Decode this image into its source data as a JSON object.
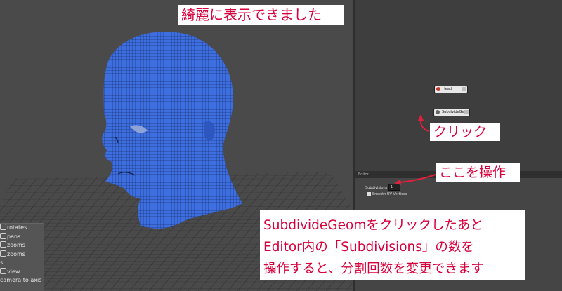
{
  "viewport": {
    "hud_items": [
      "rotates",
      "pans",
      "zooms",
      "zooms",
      "s",
      "view",
      "camera to axis"
    ]
  },
  "graph": {
    "nodes": [
      {
        "label": "Head",
        "icon": "mesh-icon"
      },
      {
        "label": "SubdivideGeom",
        "icon": "gear-icon"
      }
    ]
  },
  "attribute_editor": {
    "header": "Editor",
    "subdivisions_label": "Subdivisions",
    "subdivisions_value": "1",
    "smooth_uv_label": "Smooth UV Vertices"
  },
  "annotations": {
    "title": "綺麗に表示できました",
    "click": "クリック",
    "operate": "ここを操作",
    "description_lines": [
      "SubdivideGeomをクリックしたあと",
      "Editor内の「Subdivisions」の数を",
      "操作すると、分割回数を変更できます"
    ]
  },
  "colors": {
    "mesh": "#3e6fe0",
    "annotation_text": "#d8003c",
    "arrow": "#e0203c"
  }
}
